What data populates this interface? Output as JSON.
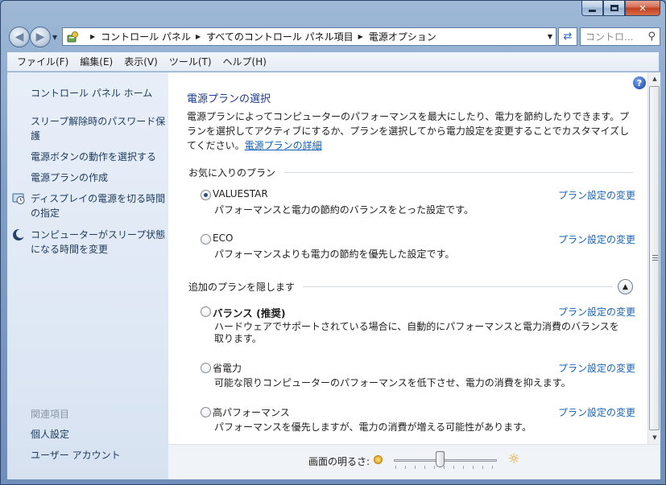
{
  "window": {
    "caption_buttons": [
      "minimize",
      "maximize",
      "close"
    ],
    "close_glyph": "✕"
  },
  "address": {
    "icon": "control-panel-icon",
    "crumbs": [
      "コントロール パネル",
      "すべてのコントロール パネル項目",
      "電源オプション"
    ],
    "search_placeholder": "コントロ...",
    "search_icon": "magnifier-icon"
  },
  "menu": [
    "ファイル(F)",
    "編集(E)",
    "表示(V)",
    "ツール(T)",
    "ヘルプ(H)"
  ],
  "sidebar": {
    "home": "コントロール パネル ホーム",
    "links": [
      "スリープ解除時のパスワード保護",
      "電源ボタンの動作を選択する",
      "電源プランの作成",
      "ディスプレイの電源を切る時間の指定",
      "コンピューターがスリープ状態になる時間を変更"
    ],
    "related_heading": "関連項目",
    "related": [
      "個人設定",
      "ユーザー アカウント"
    ]
  },
  "content": {
    "title": "電源プランの選択",
    "description": "電源プランによってコンピューターのパフォーマンスを最大にしたり、電力を節約したりできます。プランを選択してアクティブにするか、プランを選択してから電力設定を変更することでカスタマイズしてください。",
    "description_link": "電源プランの詳細",
    "favorites_header": "お気に入りのプラン",
    "hidden_header": "追加のプランを隠します",
    "change_link": "プラン設定の変更",
    "favorite_plans": [
      {
        "name": "VALUESTAR",
        "selected": true,
        "description": "パフォーマンスと電力の節約のバランスをとった設定です。"
      },
      {
        "name": "ECO",
        "selected": false,
        "description": "パフォーマンスよりも電力の節約を優先した設定です。"
      }
    ],
    "additional_plans": [
      {
        "name": "バランス (推奨)",
        "selected": false,
        "description": "ハードウェアでサポートされている場合に、自動的にパフォーマンスと電力消費のバランスを取ります。"
      },
      {
        "name": "省電力",
        "selected": false,
        "description": "可能な限りコンピューターのパフォーマンスを低下させ、電力の消費を抑えます。"
      },
      {
        "name": "高パフォーマンス",
        "selected": false,
        "description": "パフォーマンスを優先しますが、電力の消費が増える可能性があります。"
      }
    ]
  },
  "brightness": {
    "label": "画面の明るさ:",
    "level_fraction": 0.45
  }
}
